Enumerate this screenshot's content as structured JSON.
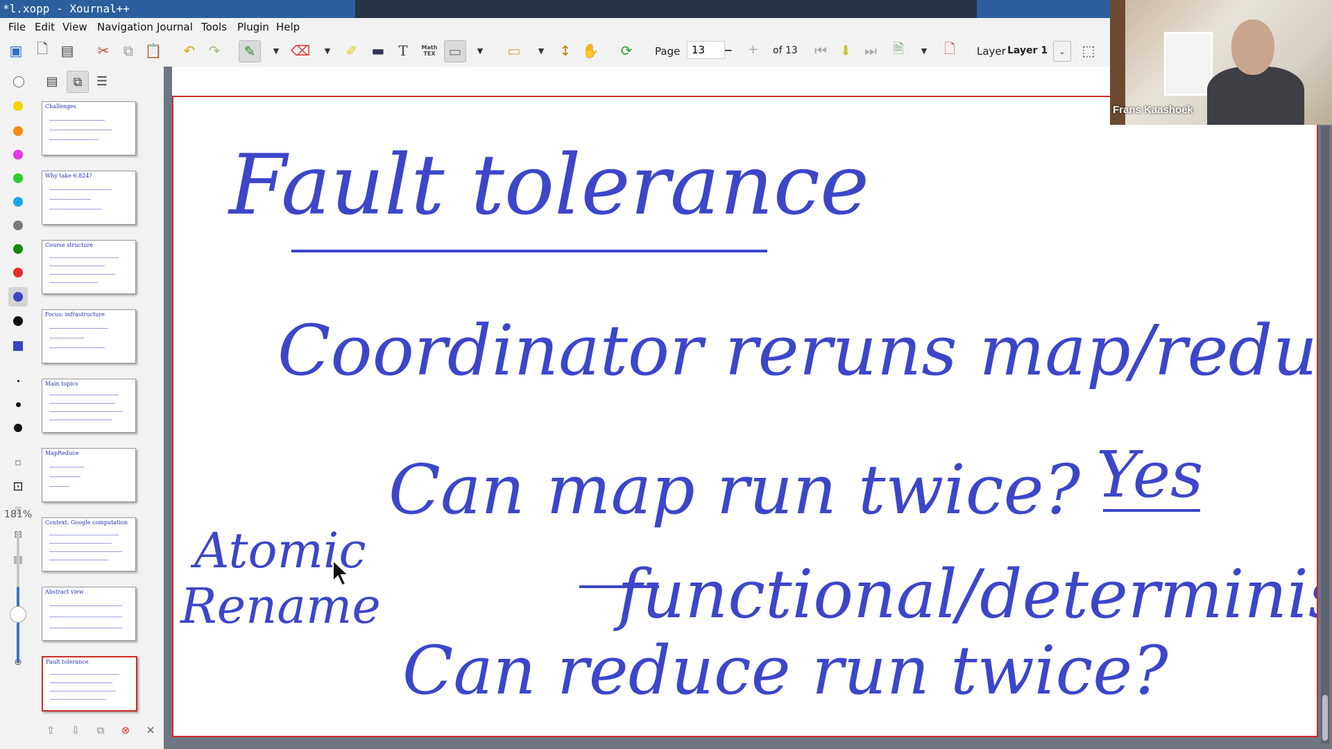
{
  "window": {
    "title": "*l.xopp - Xournal++"
  },
  "menu": [
    "File",
    "Edit",
    "View",
    "Navigation",
    "Journal",
    "Tools",
    "Plugin",
    "Help"
  ],
  "toolbar": {
    "page_label": "Page",
    "page_value": "13",
    "of_label": "of 13",
    "layer_label": "Layer",
    "layer_value": "Layer 1",
    "mathtex_line1": "Math",
    "mathtex_line2": "TEX"
  },
  "colors": {
    "yellow": "#f2d500",
    "orange": "#f28a14",
    "magenta": "#e535e5",
    "green": "#2ecc2e",
    "cyan": "#1aa6e6",
    "gray": "#7a7a7a",
    "darkgreen": "#128a12",
    "red": "#e62c2c",
    "blue": "#3a45c5",
    "black": "#111111",
    "ink": "#3d46c9"
  },
  "sidebar": {
    "zoom": "181%",
    "thumbnails": [
      {
        "label": "Challenges"
      },
      {
        "label": "Why take 6.824?"
      },
      {
        "label": "Course structure"
      },
      {
        "label": "Focus: infrastructure"
      },
      {
        "label": "Main topics"
      },
      {
        "label": "MapReduce"
      },
      {
        "label": "Context: Google computation"
      },
      {
        "label": "Abstract view"
      },
      {
        "label": "Fault tolerance"
      }
    ]
  },
  "page": {
    "title": "Fault tolerance",
    "line1": "Coordinator reruns map/reduce",
    "line2": "Can map run twice?",
    "line2_answer": "Yes",
    "line3": "functional/deterministic",
    "line4": "Can reduce run twice?",
    "side_note_1": "Atomic",
    "side_note_2": "Rename"
  },
  "webcam": {
    "name": "Frans Kaashoek"
  }
}
